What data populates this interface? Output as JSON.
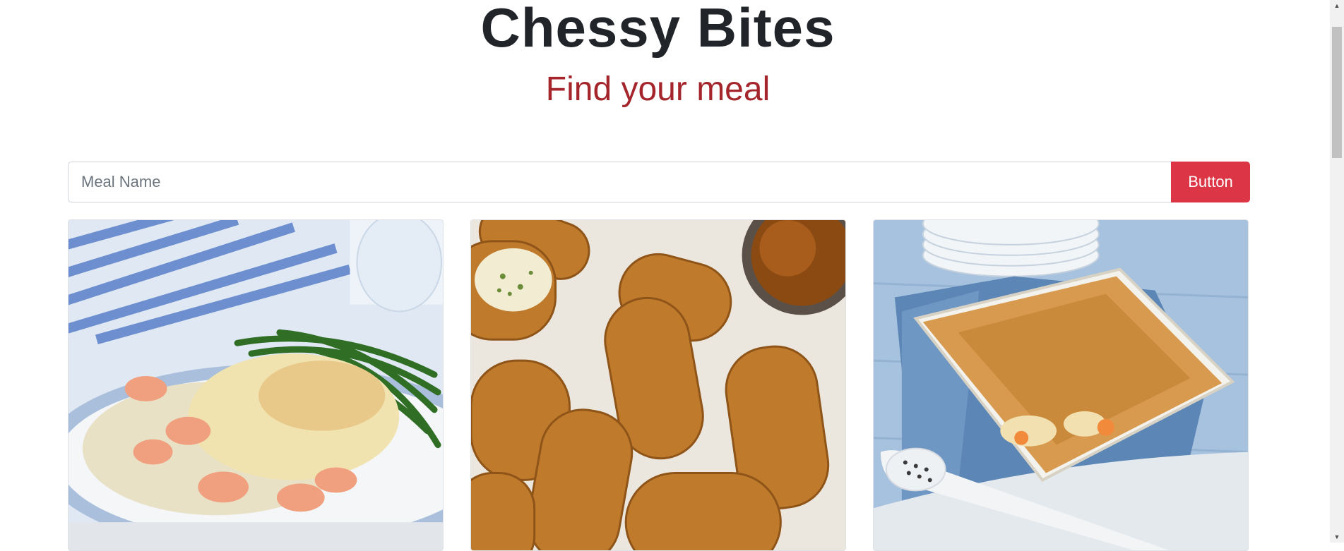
{
  "header": {
    "title": "Chessy Bites",
    "subtitle": "Find your meal"
  },
  "search": {
    "placeholder": "Meal Name",
    "value": "",
    "button_label": "Button"
  },
  "colors": {
    "accent": "#dc3545",
    "subtitle": "#a4262c",
    "title": "#212529"
  },
  "meals": [
    {
      "image": "fish-pie-with-green-beans"
    },
    {
      "image": "fried-croquettes-with-dip"
    },
    {
      "image": "baked-gratin-casserole"
    }
  ],
  "scrollbar": {
    "up_icon": "arrow-up-icon",
    "down_icon": "arrow-down-icon"
  }
}
